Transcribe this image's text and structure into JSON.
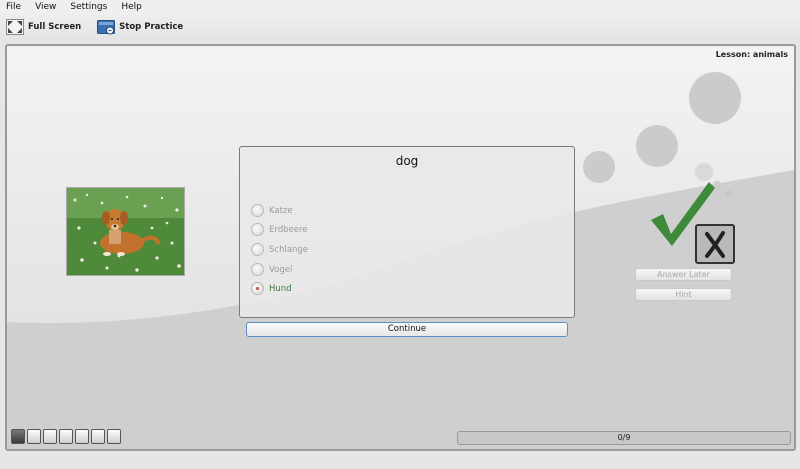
{
  "menubar": {
    "items": [
      {
        "label": "File"
      },
      {
        "label": "View"
      },
      {
        "label": "Settings"
      },
      {
        "label": "Help"
      }
    ]
  },
  "toolbar": {
    "full_screen_label": "Full Screen",
    "full_screen_icon": "fullscreen-icon",
    "stop_practice_label": "Stop Practice",
    "stop_practice_icon": "stop-practice-icon"
  },
  "practice": {
    "lesson_label": "Lesson: animals",
    "image_subject": "dog in meadow",
    "question": "dog",
    "options": [
      {
        "label": "Katze",
        "selected": false
      },
      {
        "label": "Erdbeere",
        "selected": false
      },
      {
        "label": "Schlange",
        "selected": false
      },
      {
        "label": "Vogel",
        "selected": false
      },
      {
        "label": "Hund",
        "selected": true
      }
    ],
    "continue_label": "Continue",
    "answer_later_label": "Answer Later",
    "hint_label": "Hint",
    "correct_icon": "checkmark-icon",
    "wrong_icon": "cross-icon",
    "progress_text": "0/9",
    "progress_fraction": 0,
    "stack_count": 7
  },
  "colors": {
    "accent_blue": "#5c8dc8",
    "correct_green": "#3d8a3a",
    "frame_gray": "#d2d2d2"
  }
}
